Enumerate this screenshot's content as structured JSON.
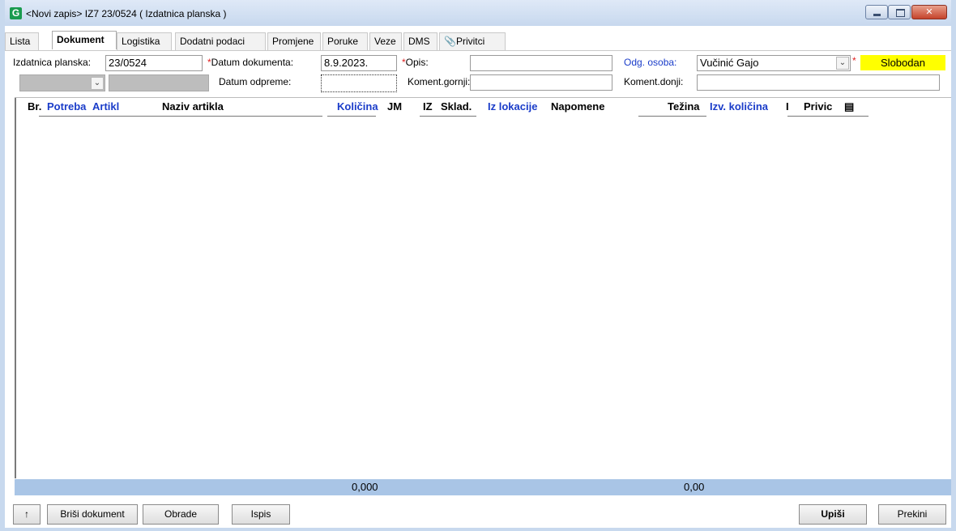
{
  "window": {
    "title": "<Novi zapis> IZ7 23/0524  ( Izdatnica planska )",
    "app_icon": "G"
  },
  "tabs": [
    {
      "label": "Lista"
    },
    {
      "label": "Dokument"
    },
    {
      "label": "Logistika"
    },
    {
      "label": "Dodatni podaci"
    },
    {
      "label": "Promjene"
    },
    {
      "label": "Poruke"
    },
    {
      "label": "Veze"
    },
    {
      "label": "DMS"
    },
    {
      "label": "Privitci"
    }
  ],
  "form": {
    "izdatnica_label": "Izdatnica planska:",
    "izdatnica_value": "23/0524",
    "datum_dokumenta_label": "Datum dokumenta:",
    "datum_dokumenta_value": "8.9.2023.",
    "datum_odpreme_label": "Datum odpreme:",
    "datum_odpreme_value": "",
    "opis_label": "Opis:",
    "opis_value": "",
    "koment_gornji_label": "Koment.gornji:",
    "koment_gornji_value": "",
    "odg_osoba_label": "Odg. osoba:",
    "odg_osoba_value": "Vučinić Gajo",
    "koment_donji_label": "Koment.donji:",
    "koment_donji_value": "",
    "status": "Slobodan",
    "required_mark": "*"
  },
  "grid": {
    "columns": [
      {
        "label": "Br."
      },
      {
        "label": "Potreba"
      },
      {
        "label": "Artikl"
      },
      {
        "label": "Naziv artikla"
      },
      {
        "label": "Količina"
      },
      {
        "label": "JM"
      },
      {
        "label": "IZ"
      },
      {
        "label": "Sklad."
      },
      {
        "label": "Iz lokacije"
      },
      {
        "label": "Napomene"
      },
      {
        "label": "Težina"
      },
      {
        "label": "Izv. količina"
      },
      {
        "label": "I"
      },
      {
        "label": "Privic"
      },
      {
        "label": "▤"
      }
    ],
    "rows": [],
    "totals": {
      "kolicina": "0,000",
      "tezina": "0,00"
    }
  },
  "buttons": {
    "up": "↑",
    "brisi": "Briši dokument",
    "obrade": "Obrade",
    "ispis": "Ispis",
    "upisi": "Upiši",
    "prekini": "Prekini"
  },
  "colors": {
    "titlebar": "#c7d8ee",
    "status_highlight": "#ffff00",
    "link_blue": "#1a3cc9",
    "totals_bar": "#a9c5e6",
    "required_red": "#e02020"
  }
}
